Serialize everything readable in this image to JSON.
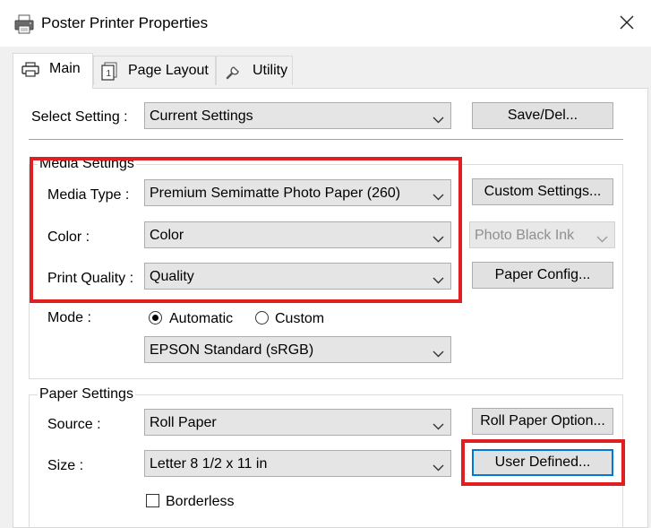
{
  "window": {
    "title": "Poster Printer Properties",
    "close_icon": "close-icon"
  },
  "tabs": [
    {
      "label": "Main",
      "icon": "printer-icon",
      "active": true
    },
    {
      "label": "Page Layout",
      "icon": "page-layout-icon",
      "active": false
    },
    {
      "label": "Utility",
      "icon": "wrench-icon",
      "active": false
    }
  ],
  "select_setting": {
    "label": "Select Setting :",
    "value": "Current Settings",
    "save_button": "Save/Del..."
  },
  "media_settings": {
    "title": "Media Settings",
    "media_type_label": "Media Type :",
    "media_type_value": "Premium Semimatte Photo Paper (260)",
    "custom_settings_button": "Custom Settings...",
    "color_label": "Color :",
    "color_value": "Color",
    "ink_value": "Photo Black Ink",
    "print_quality_label": "Print Quality :",
    "print_quality_value": "Quality",
    "paper_config_button": "Paper Config...",
    "mode_label": "Mode :",
    "mode_automatic": "Automatic",
    "mode_custom": "Custom",
    "mode_selected": "Automatic",
    "mode_profile_value": "EPSON Standard (sRGB)"
  },
  "paper_settings": {
    "title": "Paper Settings",
    "source_label": "Source :",
    "source_value": "Roll Paper",
    "roll_paper_option_button": "Roll Paper Option...",
    "size_label": "Size :",
    "size_value": "Letter 8 1/2 x 11 in",
    "user_defined_button": "User Defined...",
    "borderless_label": "Borderless",
    "borderless_checked": false
  },
  "colors": {
    "annotation_red": "#e02020",
    "focus_blue": "#0078d7"
  }
}
